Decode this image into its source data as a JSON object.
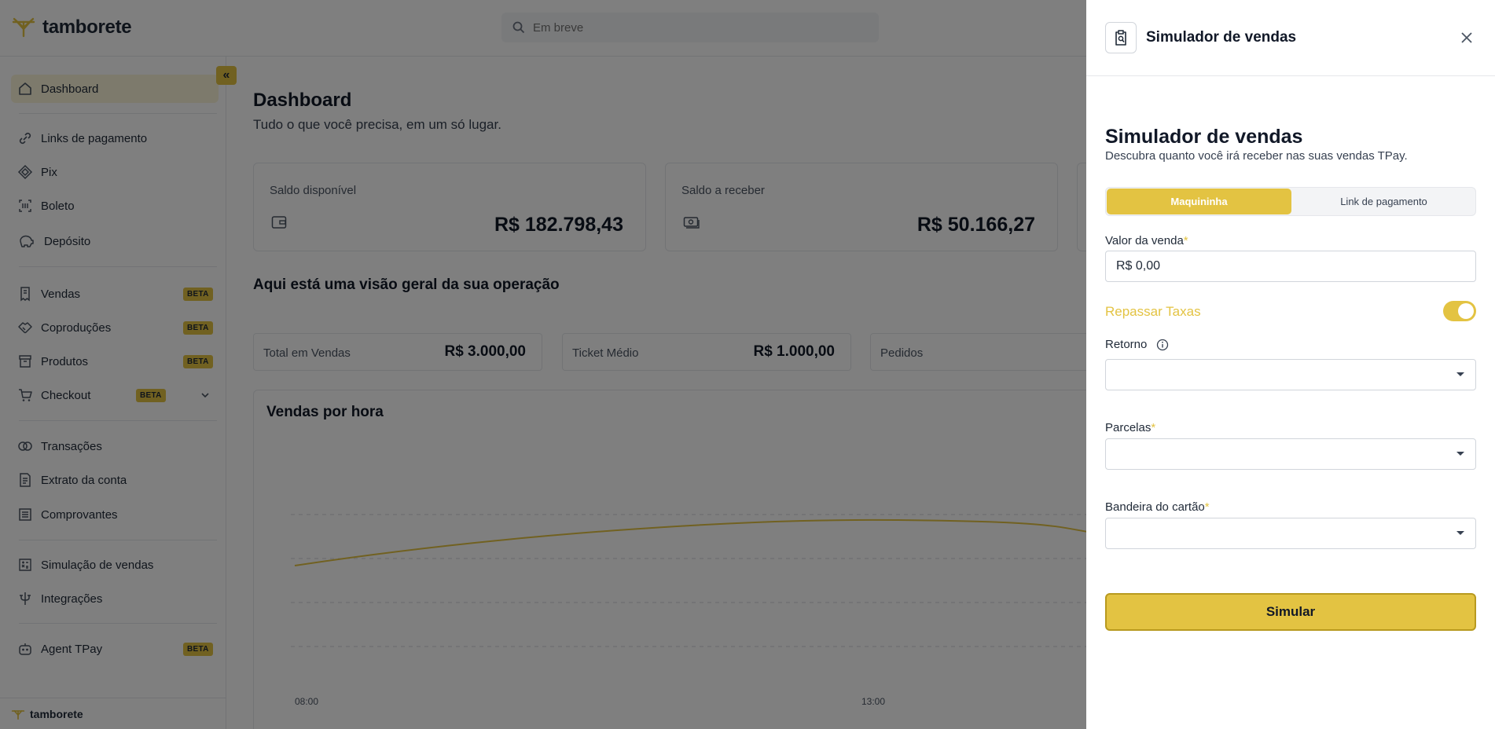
{
  "brand": {
    "name": "tamborete",
    "accent": "#e3c342"
  },
  "search": {
    "placeholder": "Em breve"
  },
  "sidebar": {
    "items": [
      {
        "label": "Dashboard",
        "icon": "home-icon"
      },
      {
        "label": "Links de pagamento",
        "icon": "link-icon"
      },
      {
        "label": "Pix",
        "icon": "pix-icon"
      },
      {
        "label": "Boleto",
        "icon": "barcode-icon"
      },
      {
        "label": "Depósito",
        "icon": "piggy-bank-icon"
      },
      {
        "label": "Vendas",
        "icon": "receipt-icon",
        "badge": "BETA"
      },
      {
        "label": "Coproduções",
        "icon": "handshake-icon",
        "badge": "BETA"
      },
      {
        "label": "Produtos",
        "icon": "box-icon",
        "badge": "BETA"
      },
      {
        "label": "Checkout",
        "icon": "cart-icon",
        "badge": "BETA"
      },
      {
        "label": "Transações",
        "icon": "transactions-icon"
      },
      {
        "label": "Extrato da conta",
        "icon": "statement-icon"
      },
      {
        "label": "Comprovantes",
        "icon": "list-icon"
      },
      {
        "label": "Simulação de vendas",
        "icon": "calculator-icon"
      },
      {
        "label": "Integrações",
        "icon": "plug-icon"
      },
      {
        "label": "Agent TPay",
        "icon": "robot-icon",
        "badge": "BETA"
      }
    ],
    "footer_logo": "tamborete"
  },
  "dashboard": {
    "title": "Dashboard",
    "subtitle": "Tudo o que você precisa, em um só lugar.",
    "cards": [
      {
        "label": "Saldo disponível",
        "value": "R$ 182.798,43"
      },
      {
        "label": "Saldo a receber",
        "value": "R$ 50.166,27"
      }
    ],
    "overview_title": "Aqui está uma visão geral da sua operação",
    "metrics": [
      {
        "label": "Total em Vendas",
        "value": "R$ 3.000,00"
      },
      {
        "label": "Ticket Médio",
        "value": "R$ 1.000,00"
      },
      {
        "label": "Pedidos",
        "value": ""
      }
    ]
  },
  "chart_data": {
    "type": "line",
    "title": "Vendas por hora",
    "x_tick_labels": [
      "08:00",
      "13:00"
    ],
    "series": [
      {
        "color": "#e3c342"
      }
    ],
    "grid": true
  },
  "panel": {
    "header_title": "Simulador de vendas",
    "title": "Simulador de vendas",
    "subtitle": "Descubra quanto você irá receber nas suas vendas TPay.",
    "tabs": [
      "Maquininha",
      "Link de pagamento"
    ],
    "active_tab": "Maquininha",
    "valor_label": "Valor da venda",
    "valor_value": "R$ 0,00",
    "repassar_label": "Repassar Taxas",
    "repassar_on": true,
    "retorno_label": "Retorno",
    "parcelas_label": "Parcelas",
    "bandeira_label": "Bandeira do cartão",
    "required_mark": "*",
    "submit_label": "Simular"
  }
}
